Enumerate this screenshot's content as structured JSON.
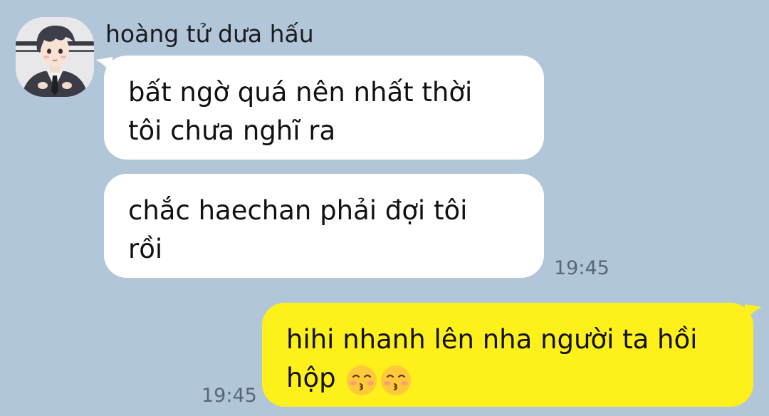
{
  "conversation": {
    "contact": {
      "name": "hoàng tử dưa hấu",
      "avatar_icon": "anime-boy-avatar-icon"
    },
    "messages": [
      {
        "direction": "incoming",
        "text": "bất ngờ quá nên nhất thời\ntôi chưa nghĩ ra"
      },
      {
        "direction": "incoming",
        "text": "chắc haechan phải đợi tôi\nrồi",
        "time": "19:45"
      },
      {
        "direction": "outgoing",
        "text": "hihi nhanh lên nha người ta hồi\nhộp",
        "emoji": [
          "kissing-closed-eyes-emoji",
          "kissing-closed-eyes-emoji"
        ],
        "time": "19:45"
      }
    ]
  },
  "colors": {
    "background": "#b2c6d9",
    "incoming_bubble": "#ffffff",
    "outgoing_bubble": "#fef01b",
    "timestamp": "#5a6676"
  }
}
